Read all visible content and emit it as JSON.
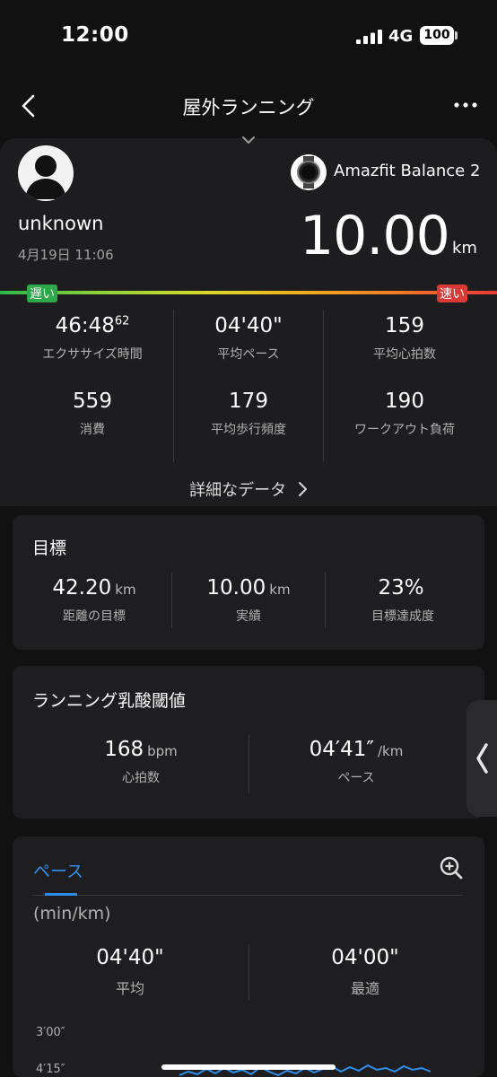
{
  "status_bar": {
    "time": "12:00",
    "network": "4G",
    "battery": "100"
  },
  "nav": {
    "title": "屋外ランニング",
    "back_icon": "chevron-left-icon",
    "more_icon": "ellipsis-icon"
  },
  "header": {
    "username": "unknown",
    "datetime": "4月19日 11:06",
    "device": "Amazfit Balance 2",
    "distance": "10.00",
    "distance_unit": "km",
    "speed_slow": "遅い",
    "speed_fast": "速い"
  },
  "stats": [
    {
      "value": "46:48",
      "sup": "62",
      "label": "エクササイズ時間"
    },
    {
      "value": "04'40\"",
      "label": "平均ペース"
    },
    {
      "value": "159",
      "label": "平均心拍数"
    },
    {
      "value": "559",
      "label": "消費"
    },
    {
      "value": "179",
      "label": "平均歩行頻度"
    },
    {
      "value": "190",
      "label": "ワークアウト負荷"
    }
  ],
  "detail_link": "詳細なデータ",
  "goal": {
    "title": "目標",
    "metrics": [
      {
        "value": "42.20",
        "unit": "km",
        "label": "距離の目標"
      },
      {
        "value": "10.00",
        "unit": "km",
        "label": "実績"
      },
      {
        "value": "23%",
        "unit": "",
        "label": "目標達成度"
      }
    ]
  },
  "threshold": {
    "title": "ランニング乳酸閾値",
    "metrics": [
      {
        "value": "168",
        "unit": "bpm",
        "label": "心拍数"
      },
      {
        "value": "04′41″",
        "unit": "/km",
        "label": "ペース"
      }
    ]
  },
  "pace_chart": {
    "tab": "ペース",
    "unit": "(min/km)",
    "avg_value": "04'40\"",
    "avg_label": "平均",
    "best_value": "04'00\"",
    "best_label": "最適",
    "y_ticks": [
      "3′00″",
      "4′15″"
    ],
    "line_color": "#2f8fe8"
  },
  "colors": {
    "accent": "#2f8fe8",
    "background": "#111111",
    "card": "#1e1e20"
  }
}
